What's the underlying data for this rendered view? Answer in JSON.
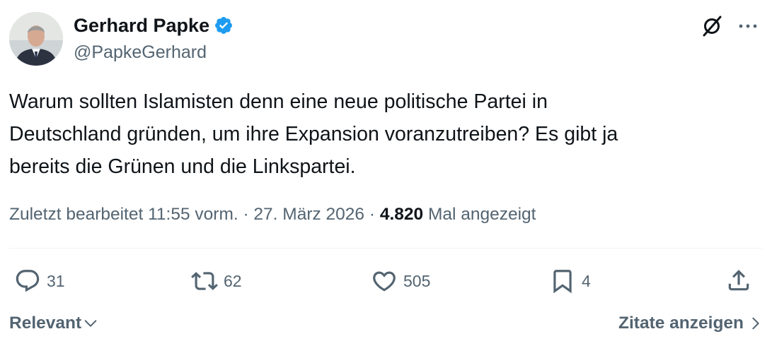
{
  "author": {
    "name": "Gerhard Papke",
    "handle": "@PapkeGerhard",
    "verified": true
  },
  "tweet": {
    "text": "Warum sollten Islamisten denn eine neue politische Partei in\nDeutschland gründen, um ihre Expansion voranzutreiben? Es gibt ja\nbereits die Grünen und die Linkspartei."
  },
  "meta": {
    "edited_timestamp": "Zuletzt bearbeitet 11:55 vorm. · 27. März 2026 · ",
    "views_count": "4.820",
    "views_label": " Mal angezeigt"
  },
  "actions": {
    "replies": "31",
    "retweets": "62",
    "likes": "505",
    "bookmarks": "4"
  },
  "footer": {
    "sort_label": "Relevant",
    "quotes_label": "Zitate anzeigen"
  },
  "colors": {
    "text": "#0f1419",
    "secondary": "#536471",
    "verified": "#1d9bf0",
    "divider": "#eff3f4"
  }
}
